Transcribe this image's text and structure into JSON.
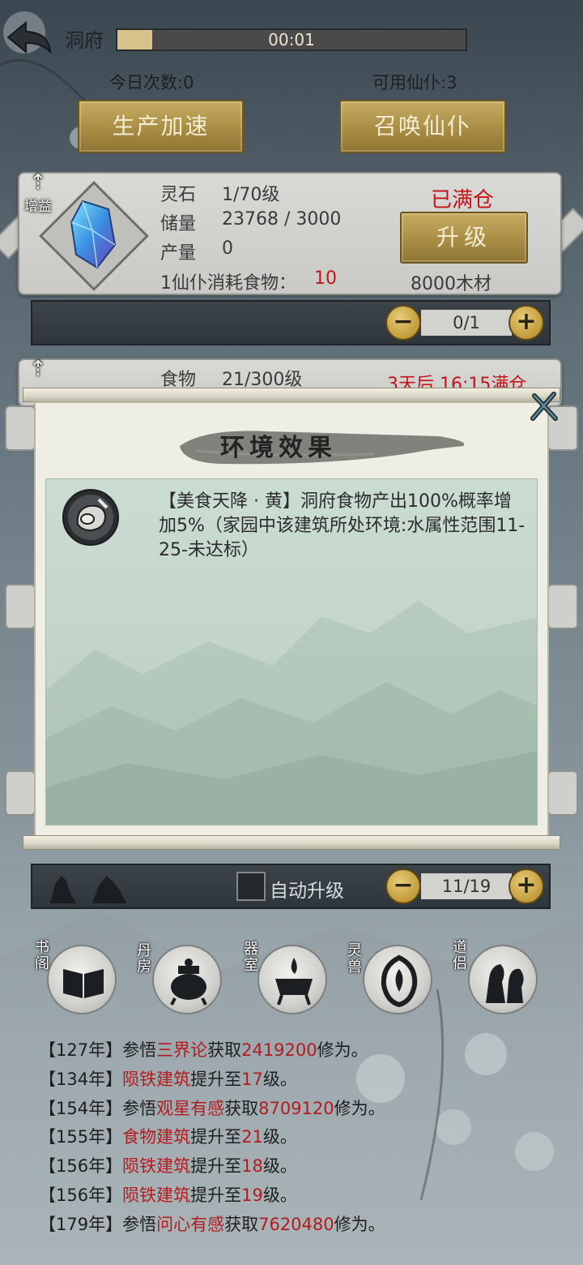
{
  "header": {
    "title": "洞府",
    "timer": "00:01",
    "timer_progress": 0.1
  },
  "stats": {
    "today_count": "今日次数:0",
    "available_servants": "可用仙仆:3"
  },
  "actions": {
    "speed_up": "生产加速",
    "summon": "召唤仙仆"
  },
  "building1": {
    "boost_tag": "增益",
    "name": "灵石",
    "level": "1/70级",
    "storage_label": "储量",
    "storage_value": "23768 / 3000",
    "output_label": "产量",
    "output_value": "0",
    "consume_label": "1仙仆消耗食物：",
    "consume_value": "10",
    "status": "已满仓",
    "upgrade": "升级",
    "upgrade_cost": "8000木材",
    "counter": "0/1"
  },
  "building2": {
    "name": "食物",
    "level": "21/300级",
    "status": "3天后 16:15满仓"
  },
  "dialog": {
    "title": "环境效果",
    "effect_text": "【美食天降 · 黄】洞府食物产出100%概率增加5%（家园中该建筑所处环境:水属性范围11-25-未达标）"
  },
  "bottom_strip": {
    "auto_upgrade": "自动升级",
    "counter": "11/19"
  },
  "nav": [
    {
      "label": "书阁",
      "icon": "book-icon"
    },
    {
      "label": "丹房",
      "icon": "cauldron-icon"
    },
    {
      "label": "器室",
      "icon": "forge-icon"
    },
    {
      "label": "灵兽",
      "icon": "phoenix-icon"
    },
    {
      "label": "道侣",
      "icon": "companion-icon"
    }
  ],
  "log": [
    {
      "year": "【127年】",
      "pre": "参悟",
      "hl1": "三界论",
      "mid": "获取",
      "hl2": "2419200",
      "post": "修为。"
    },
    {
      "year": "【134年】",
      "pre": "",
      "hl1": "陨铁建筑",
      "mid": "提升至",
      "hl2": "17",
      "post": "级。"
    },
    {
      "year": "【154年】",
      "pre": "参悟",
      "hl1": "观星有感",
      "mid": "获取",
      "hl2": "8709120",
      "post": "修为。"
    },
    {
      "year": "【155年】",
      "pre": "",
      "hl1": "食物建筑",
      "mid": "提升至",
      "hl2": "21",
      "post": "级。"
    },
    {
      "year": "【156年】",
      "pre": "",
      "hl1": "陨铁建筑",
      "mid": "提升至",
      "hl2": "18",
      "post": "级。"
    },
    {
      "year": "【156年】",
      "pre": "",
      "hl1": "陨铁建筑",
      "mid": "提升至",
      "hl2": "19",
      "post": "级。"
    },
    {
      "year": "【179年】",
      "pre": "参悟",
      "hl1": "问心有感",
      "mid": "获取",
      "hl2": "7620480",
      "post": "修为。"
    }
  ],
  "colors": {
    "highlight_red": "#c4141a",
    "gold_button": "#a98d45",
    "dialog_bg": "#efeee4"
  }
}
